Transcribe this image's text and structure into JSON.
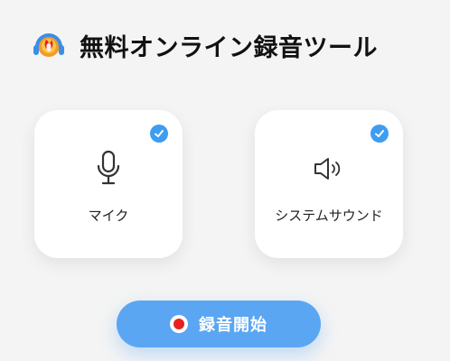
{
  "header": {
    "title": "無料オンライン録音ツール",
    "logo_icon": "headphones-mic-logo"
  },
  "sources": [
    {
      "label": "マイク",
      "icon": "microphone-icon",
      "selected": true
    },
    {
      "label": "システムサウンド",
      "icon": "speaker-icon",
      "selected": true
    }
  ],
  "record_button": {
    "label": "録音開始",
    "icon": "record-dot-icon"
  },
  "colors": {
    "accent": "#5aa6f3",
    "check": "#3e9cf2",
    "record_dot": "#e8211f",
    "background": "#f4f4f4"
  }
}
